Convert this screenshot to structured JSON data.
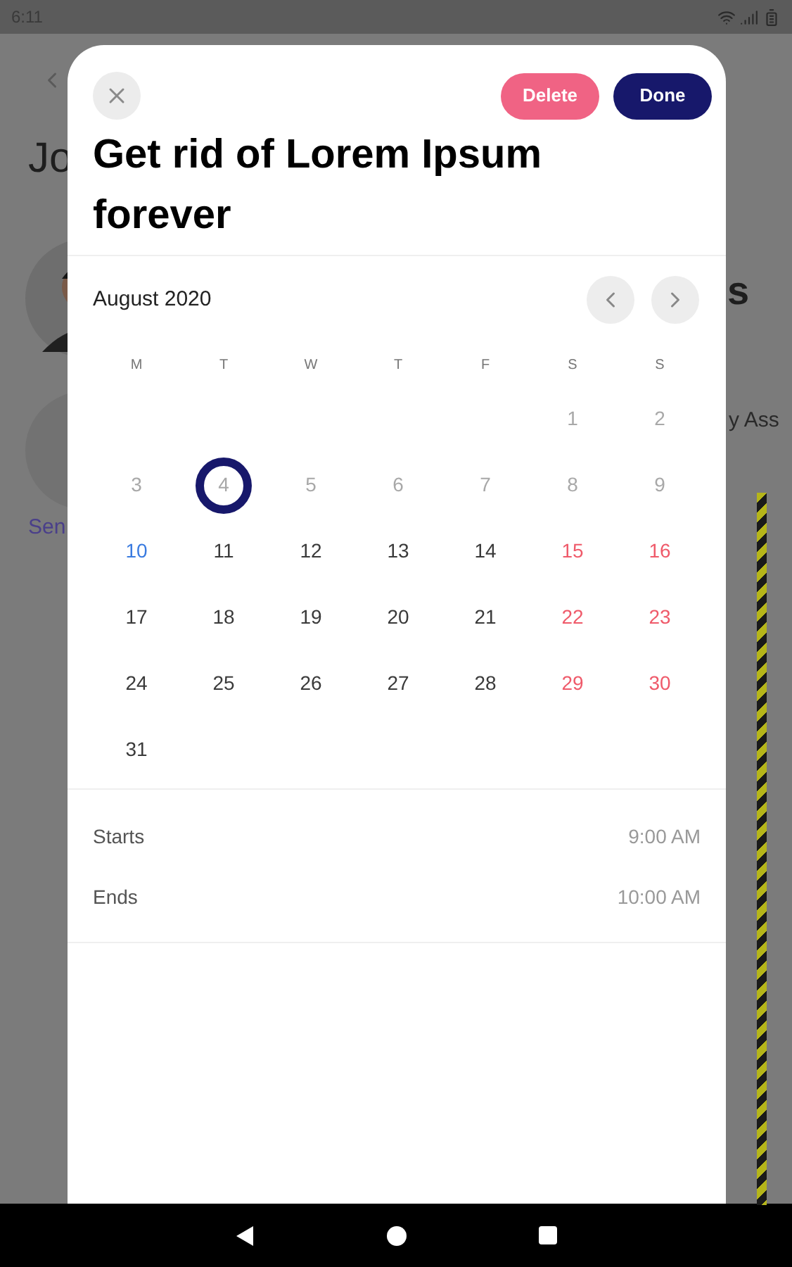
{
  "status_bar": {
    "time": "6:11"
  },
  "background": {
    "heading": "Jo",
    "link": "Sen",
    "right_heading": "s",
    "right_text": "y Ass"
  },
  "dialog": {
    "title": "Get rid of Lorem Ipsum forever",
    "buttons": [
      {
        "label": "Delete",
        "kind": "danger"
      },
      {
        "label": "Done",
        "kind": "primary"
      }
    ],
    "calendar": {
      "month": "August 2020",
      "weekdays": [
        "M",
        "T",
        "W",
        "T",
        "F",
        "S",
        "S"
      ],
      "weeks": [
        {
          "days": [
            {
              "kind": "blank"
            },
            {
              "kind": "blank"
            },
            {
              "kind": "blank"
            },
            {
              "kind": "blank"
            },
            {
              "kind": "blank"
            },
            {
              "label": "1",
              "kind": "past",
              "selected": false
            },
            {
              "label": "2",
              "kind": "past",
              "selected": false
            }
          ]
        },
        {
          "days": [
            {
              "label": "3",
              "kind": "past",
              "selected": false
            },
            {
              "label": "4",
              "kind": "past",
              "selected": true
            },
            {
              "label": "5",
              "kind": "past",
              "selected": false
            },
            {
              "label": "6",
              "kind": "past",
              "selected": false
            },
            {
              "label": "7",
              "kind": "past",
              "selected": false
            },
            {
              "label": "8",
              "kind": "past",
              "selected": false
            },
            {
              "label": "9",
              "kind": "past",
              "selected": false
            }
          ]
        },
        {
          "days": [
            {
              "label": "10",
              "kind": "today",
              "selected": false
            },
            {
              "label": "11",
              "kind": "normal",
              "selected": false
            },
            {
              "label": "12",
              "kind": "normal",
              "selected": false
            },
            {
              "label": "13",
              "kind": "normal",
              "selected": false
            },
            {
              "label": "14",
              "kind": "normal",
              "selected": false
            },
            {
              "label": "15",
              "kind": "weekend",
              "selected": false
            },
            {
              "label": "16",
              "kind": "weekend",
              "selected": false
            }
          ]
        },
        {
          "days": [
            {
              "label": "17",
              "kind": "normal",
              "selected": false
            },
            {
              "label": "18",
              "kind": "normal",
              "selected": false
            },
            {
              "label": "19",
              "kind": "normal",
              "selected": false
            },
            {
              "label": "20",
              "kind": "normal",
              "selected": false
            },
            {
              "label": "21",
              "kind": "normal",
              "selected": false
            },
            {
              "label": "22",
              "kind": "weekend",
              "selected": false
            },
            {
              "label": "23",
              "kind": "weekend",
              "selected": false
            }
          ]
        },
        {
          "days": [
            {
              "label": "24",
              "kind": "normal",
              "selected": false
            },
            {
              "label": "25",
              "kind": "normal",
              "selected": false
            },
            {
              "label": "26",
              "kind": "normal",
              "selected": false
            },
            {
              "label": "27",
              "kind": "normal",
              "selected": false
            },
            {
              "label": "28",
              "kind": "normal",
              "selected": false
            },
            {
              "label": "29",
              "kind": "weekend",
              "selected": false
            },
            {
              "label": "30",
              "kind": "weekend",
              "selected": false
            }
          ]
        },
        {
          "days": [
            {
              "label": "31",
              "kind": "normal",
              "selected": false
            }
          ]
        }
      ]
    },
    "times": [
      {
        "label": "Starts",
        "value": "9:00 AM"
      },
      {
        "label": "Ends",
        "value": "10:00 AM"
      }
    ]
  }
}
